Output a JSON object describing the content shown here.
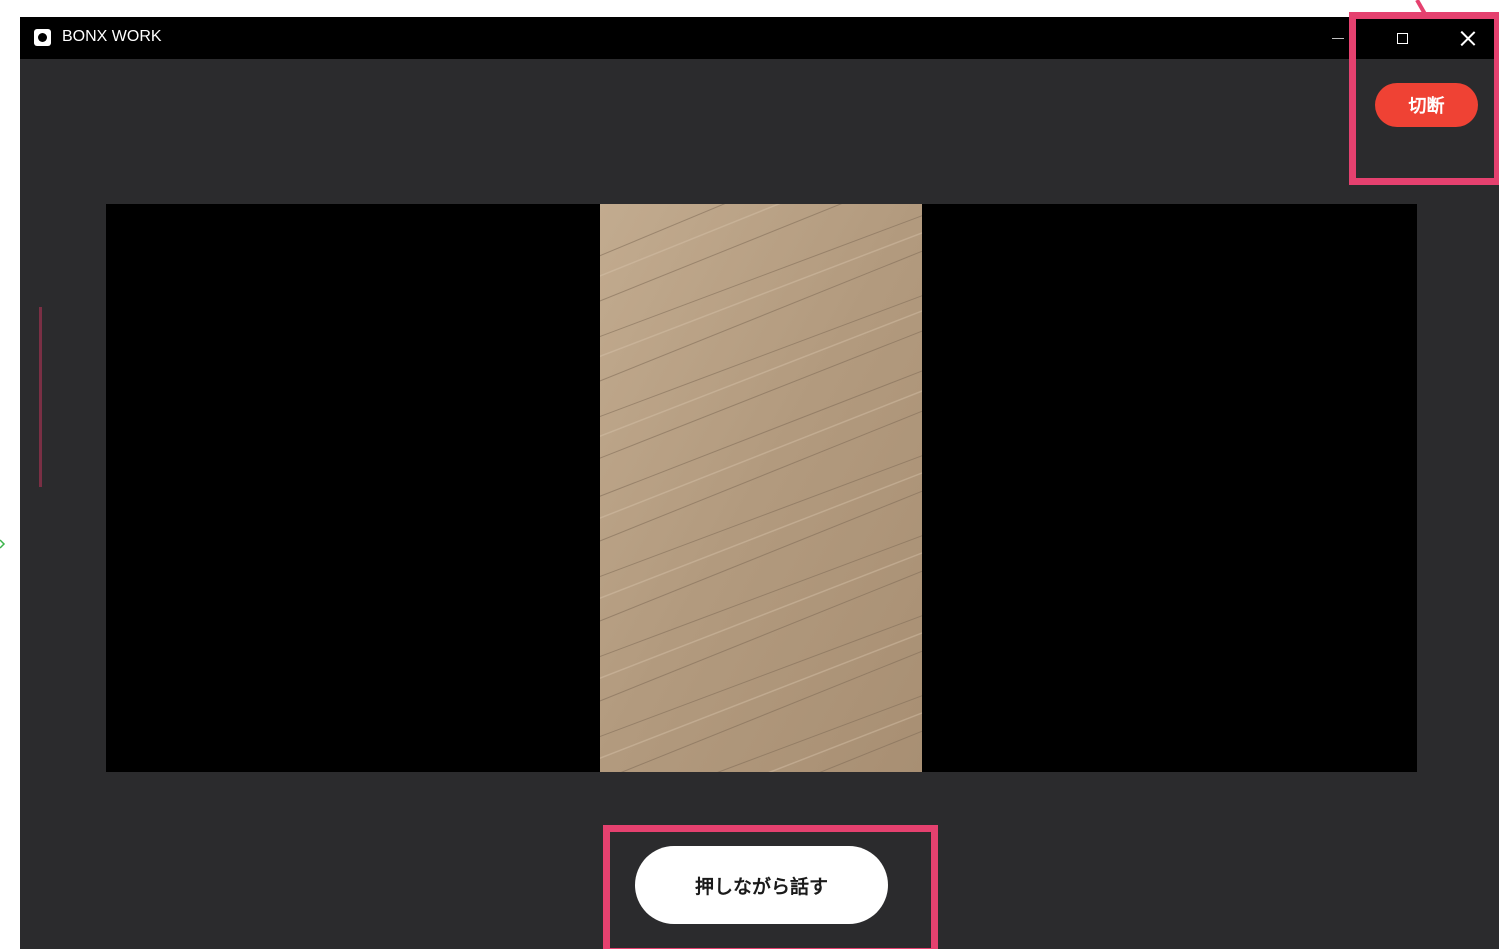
{
  "window": {
    "title": "BONX WORK",
    "controls": {
      "minimize_icon": "minimize-icon",
      "maximize_icon": "maximize-icon",
      "close_icon": "close-icon"
    }
  },
  "call": {
    "disconnect_label": "切断",
    "push_to_talk_label": "押しながら話す"
  },
  "colors": {
    "window_background": "#2b2b2d",
    "title_bar": "#000000",
    "disconnect_button": "#ef4234",
    "push_to_talk_button": "#ffffff",
    "highlight_box": "#e5416f"
  }
}
